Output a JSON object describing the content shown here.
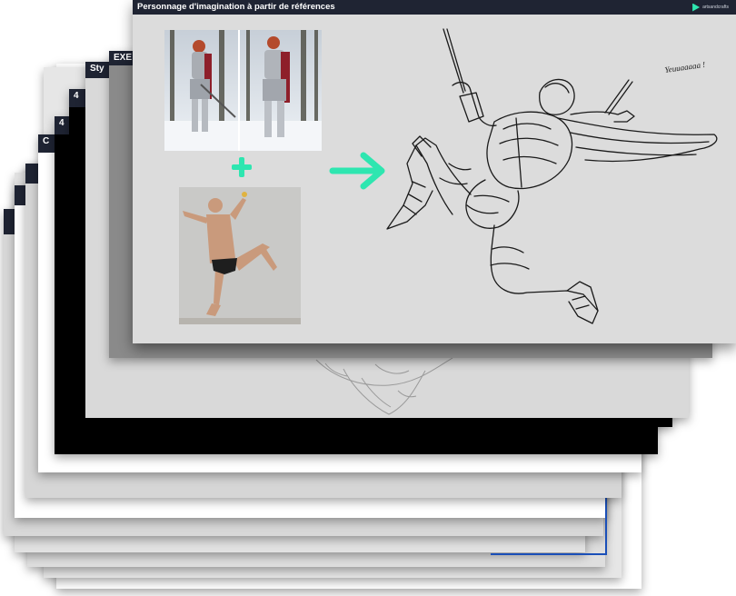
{
  "slide": {
    "title": "Personnage d'imagination à partir de références",
    "logo_text": "artsandcrafts"
  },
  "background_slides": [
    {
      "label": "EXE"
    },
    {
      "label": "Sty"
    },
    {
      "label": "4"
    },
    {
      "label": "4"
    },
    {
      "label": "C"
    }
  ],
  "sketch": {
    "shout_text": "Yeuuaaaaa !"
  },
  "colors": {
    "header": "#1f2433",
    "accent": "#2ee6b0",
    "slide_bg": "#dcdcdc"
  }
}
